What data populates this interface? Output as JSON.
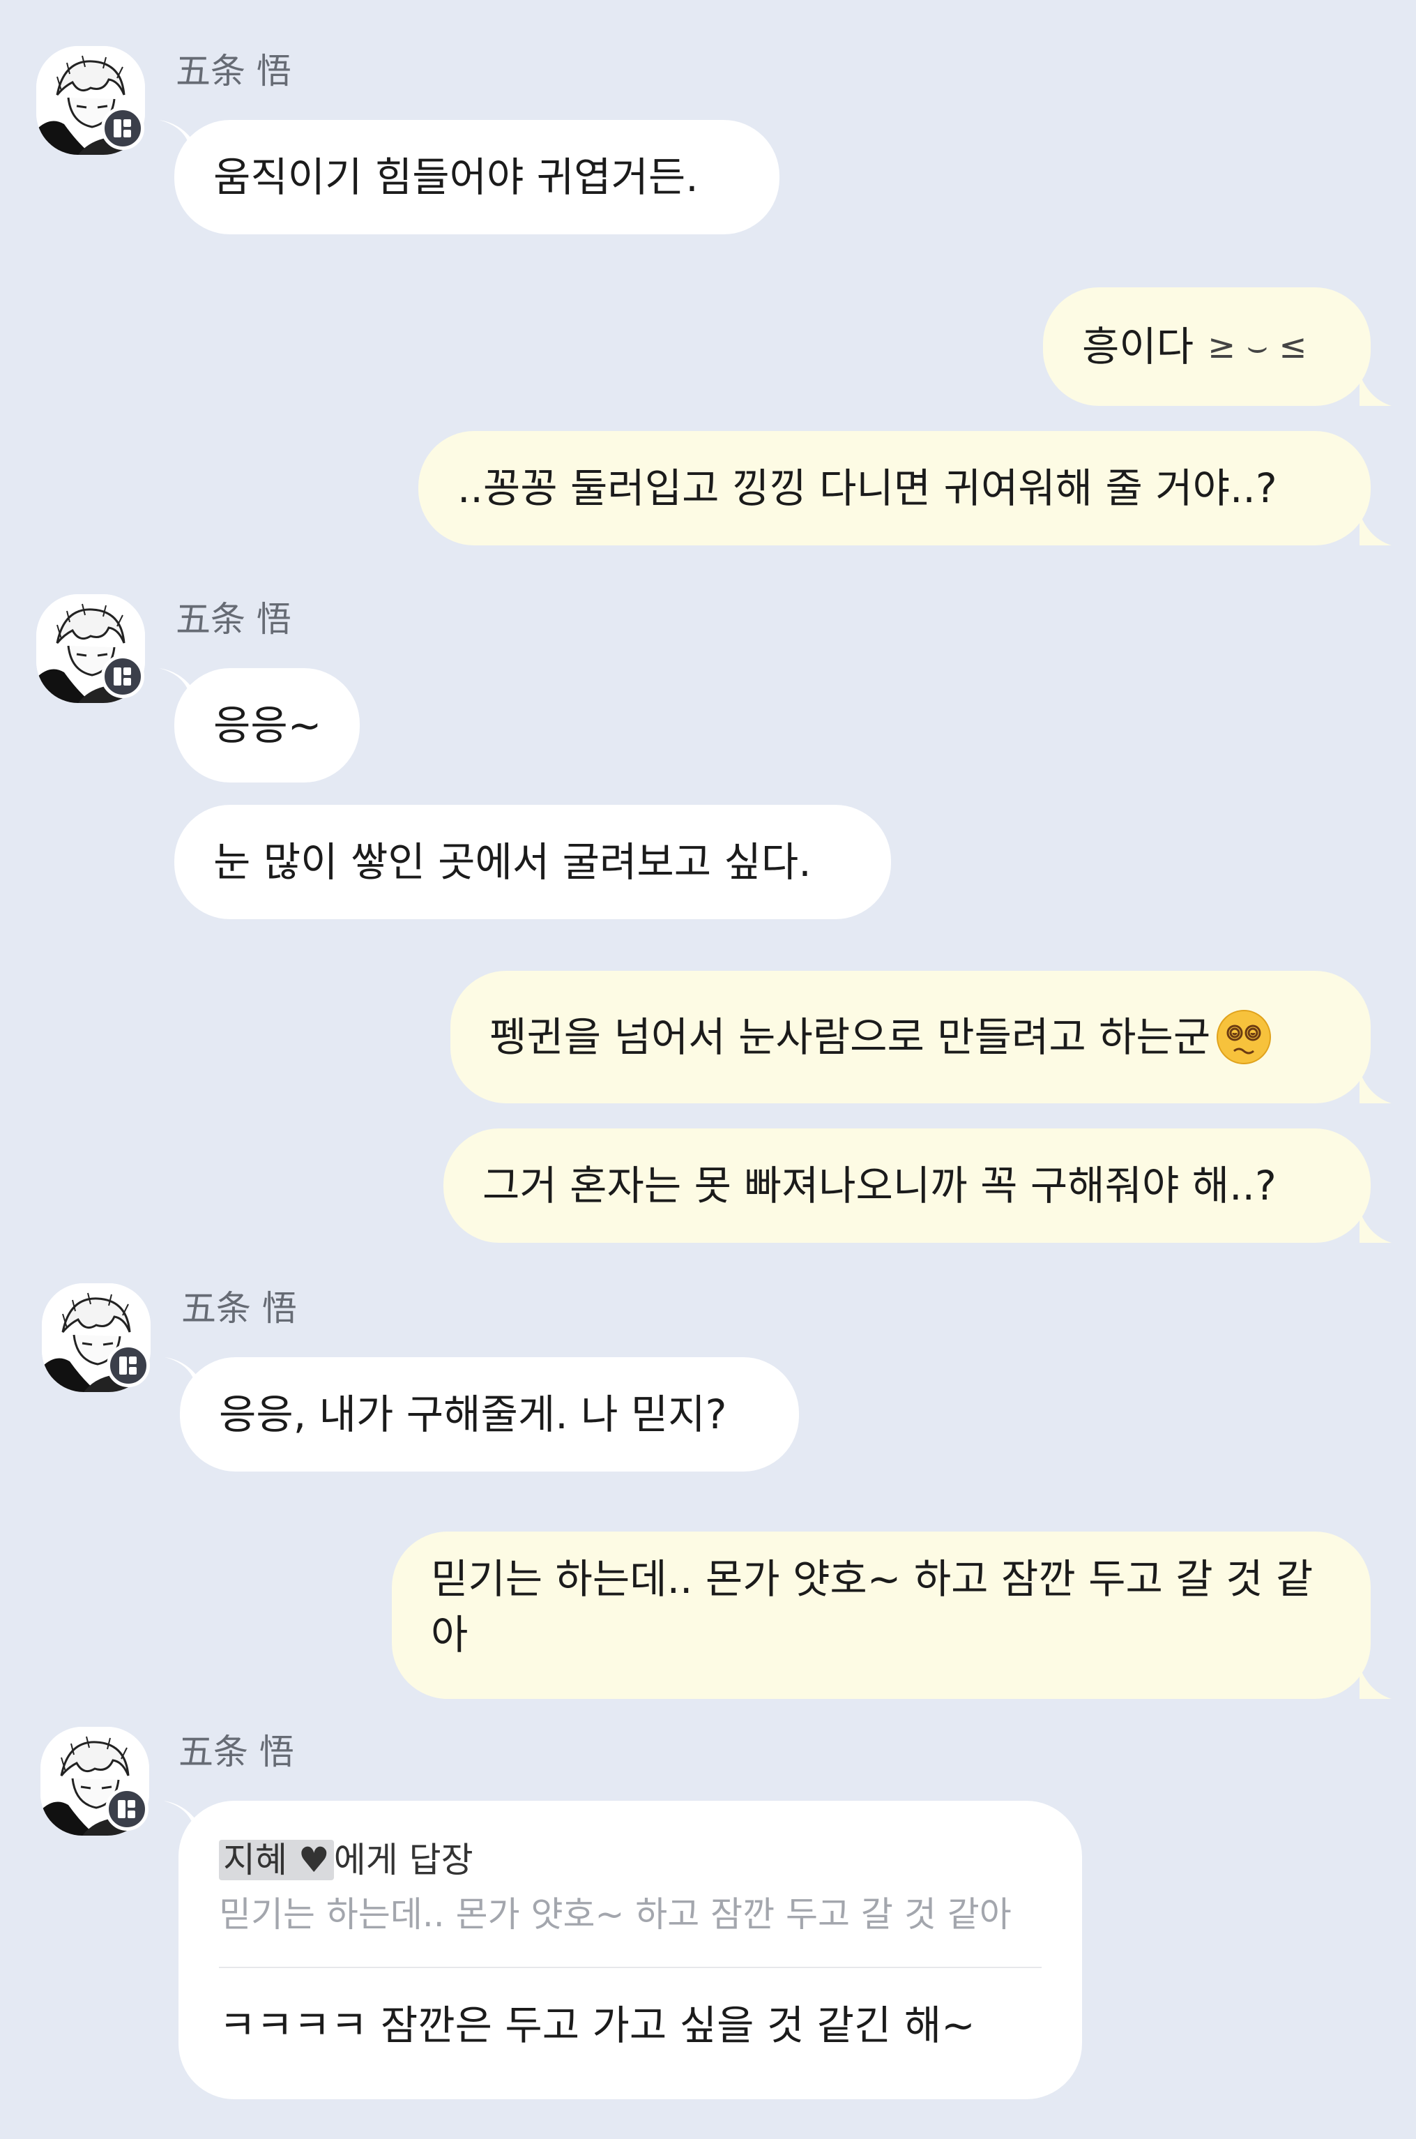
{
  "sender": {
    "name": "五条 悟"
  },
  "messages": [
    {
      "id": "m1",
      "side": "left",
      "text": "움직이기 힘들어야 귀엽거든."
    },
    {
      "id": "m2",
      "side": "right",
      "text": "흥이다",
      "suffix": "≥ ⌣ ≤"
    },
    {
      "id": "m3",
      "side": "right",
      "text": "..꽁꽁 둘러입고 낑낑 다니면 귀여워해 줄 거야..?"
    },
    {
      "id": "m4",
      "side": "left",
      "text": "응응~"
    },
    {
      "id": "m5",
      "side": "left",
      "text": "눈 많이 쌓인 곳에서 굴려보고 싶다."
    },
    {
      "id": "m6",
      "side": "right",
      "text": "펭귄을 넘어서 눈사람으로 만들려고 하는군",
      "emoji": "dizzy-face"
    },
    {
      "id": "m7",
      "side": "right",
      "text": "그거 혼자는 못 빠져나오니까 꼭 구해줘야 해..?"
    },
    {
      "id": "m8",
      "side": "left",
      "text": "응응, 내가 구해줄게. 나 믿지?"
    },
    {
      "id": "m9",
      "side": "right",
      "line1": "믿기는 하는데.. 몬가 얏호~ 하고 잠깐 두고 갈 것 같",
      "line2": "아"
    },
    {
      "id": "m10",
      "side": "left",
      "reply_to_name": "지혜 ♥",
      "reply_to_suffix": "에게 답장",
      "reply_quote": "믿기는 하는데.. 몬가 얏호~ 하고 잠깐 두고 갈 것 같아",
      "text": "ㅋㅋㅋㅋ 잠깐은 두고 가고 싶을 것 같긴 해~"
    }
  ],
  "colors": {
    "background": "#e4e9f3",
    "bubble_left": "#ffffff",
    "bubble_right": "#fdfbe4",
    "badge": "#3b3f4a",
    "name": "#666b74"
  }
}
